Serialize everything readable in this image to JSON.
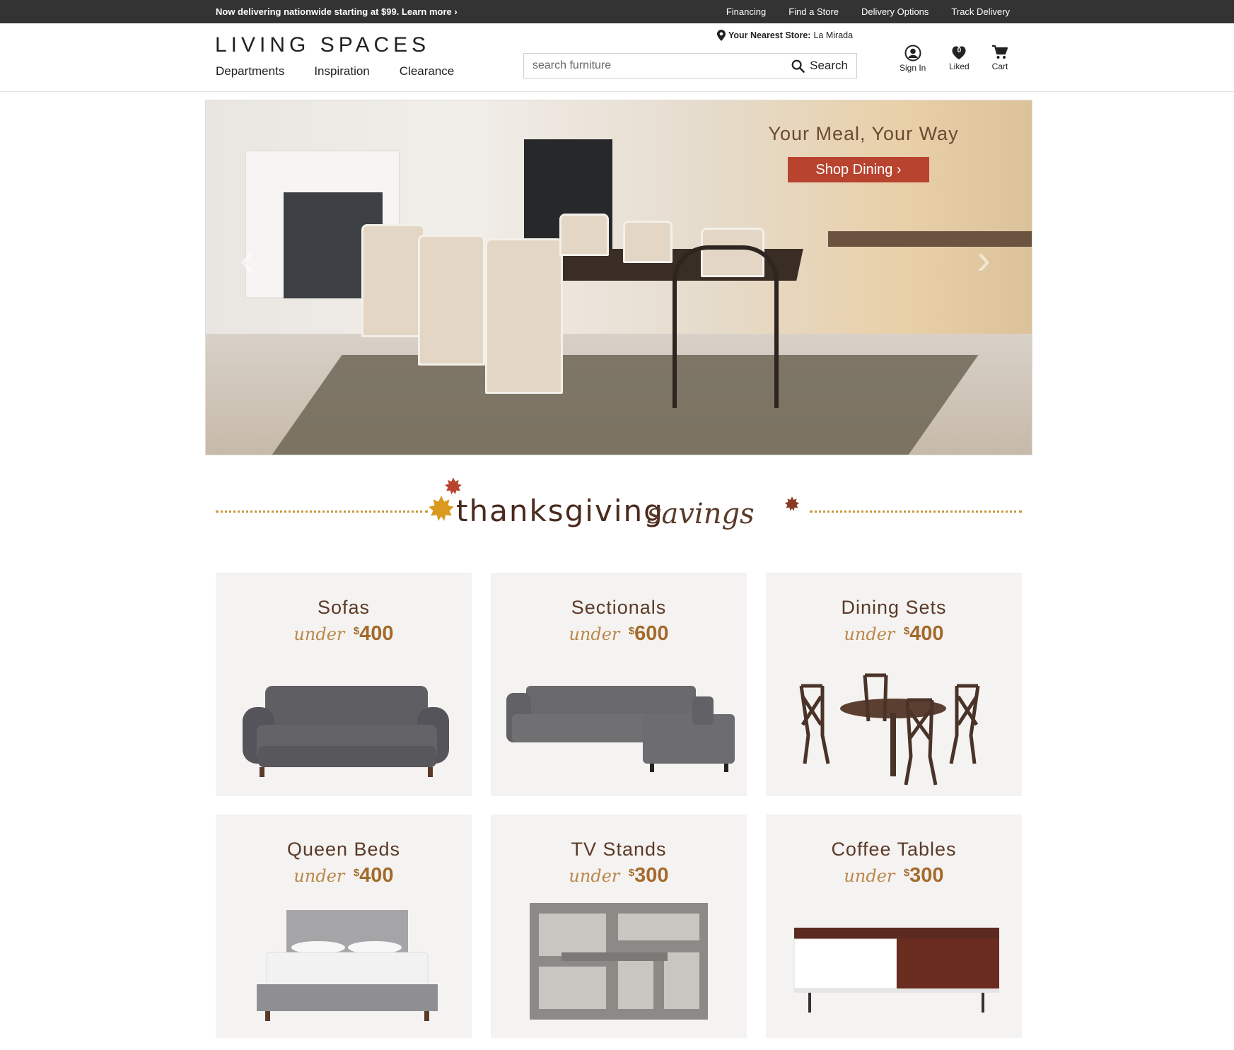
{
  "topbar": {
    "promo": "Now delivering nationwide starting at $99. Learn more ›",
    "links": [
      "Financing",
      "Find a Store",
      "Delivery Options",
      "Track Delivery"
    ]
  },
  "header": {
    "logo": "LIVING SPACES",
    "nav": [
      "Departments",
      "Inspiration",
      "Clearance"
    ],
    "store_label": "Your Nearest Store:",
    "store_name": "La Mirada",
    "search_placeholder": "search furniture",
    "search_button": "Search",
    "sign_in": "Sign In",
    "liked": "Liked",
    "liked_count": "0",
    "cart": "Cart"
  },
  "hero": {
    "headline": "Your Meal, Your Way",
    "button": "Shop Dining ›"
  },
  "banner": {
    "word1": "thanksgiving",
    "word2": "savings"
  },
  "products": [
    {
      "title": "Sofas",
      "under": "under",
      "currency": "$",
      "price": "400"
    },
    {
      "title": "Sectionals",
      "under": "under",
      "currency": "$",
      "price": "600"
    },
    {
      "title": "Dining Sets",
      "under": "under",
      "currency": "$",
      "price": "400"
    },
    {
      "title": "Queen Beds",
      "under": "under",
      "currency": "$",
      "price": "400"
    },
    {
      "title": "TV Stands",
      "under": "under",
      "currency": "$",
      "price": "300"
    },
    {
      "title": "Coffee Tables",
      "under": "under",
      "currency": "$",
      "price": "300"
    }
  ],
  "colors": {
    "topbar": "#333333",
    "accent_button": "#b8432f",
    "price": "#a46a2c",
    "title": "#5a3a28"
  }
}
